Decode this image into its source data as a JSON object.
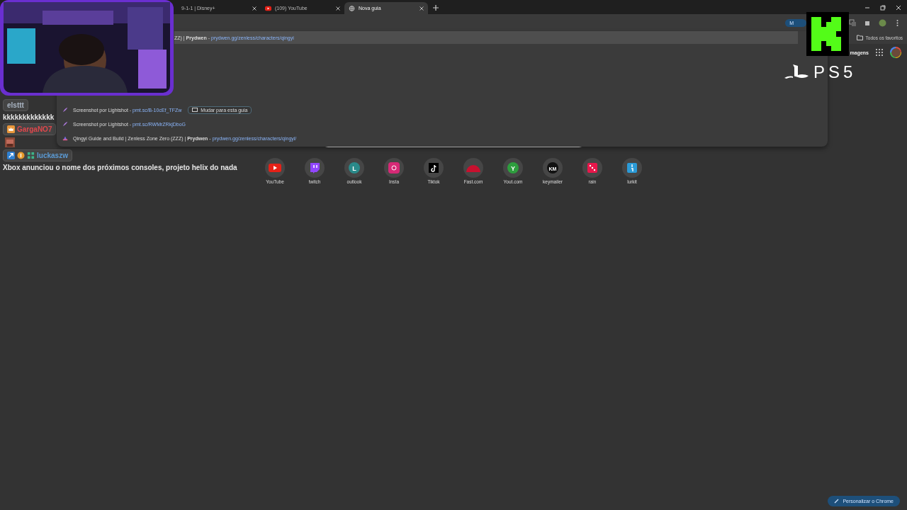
{
  "tabs": [
    {
      "title": "9-1-1 | Disney+",
      "kind": "plain",
      "selected": false
    },
    {
      "title": "(109) YouTube",
      "kind": "video",
      "selected": false
    },
    {
      "title": "Nova guia",
      "kind": "newtab",
      "selected": true
    }
  ],
  "toolbar": {
    "chip": "M"
  },
  "bookmarks_bar": {
    "folder": "Todos os favoritos"
  },
  "omnibox": {
    "text": "ZZ) | **Prydwen** - ",
    "url": "prydwen.gg/zenless/characters/qingyi",
    "suggestions": [
      {
        "kind": "feather",
        "title": "Screenshot por Lightshot - ",
        "url": "pmt.sc/B-10cEf_TFZw",
        "action": "Mudar para esta guia"
      },
      {
        "kind": "feather",
        "title": "Screenshot por Lightshot - ",
        "url": "pmt.sc/RWMrZRkjDboG"
      },
      {
        "kind": "site",
        "title": "Qingyi Guide and Build | Zenless Zone Zero (ZZZ) | **Prydwen** - ",
        "url": "prydwen.gg/zenless/characters/qingyi/"
      }
    ]
  },
  "header": {
    "link": "magens"
  },
  "shortcuts": [
    {
      "label": "YouTube",
      "kind": "youtube",
      "color": "#e62117"
    },
    {
      "label": "twitch",
      "kind": "twitch",
      "color": "#9146ff"
    },
    {
      "label": "outlook",
      "kind": "letter",
      "glyph": "L",
      "color": "#2a8a8a"
    },
    {
      "label": "Insta",
      "kind": "instagram",
      "color": "#d62976"
    },
    {
      "label": "Tiktok",
      "kind": "tiktok",
      "color": "#000000"
    },
    {
      "label": "Fast.com",
      "kind": "gauge",
      "color": "#c8102e"
    },
    {
      "label": "Yout.com",
      "kind": "letter",
      "glyph": "Y",
      "color": "#2e9e3e"
    },
    {
      "label": "keymailer",
      "kind": "letter",
      "glyph": "KM",
      "color": "#111111"
    },
    {
      "label": "rain",
      "kind": "dice",
      "color": "#e8174b"
    },
    {
      "label": "lurkit",
      "kind": "bars",
      "color": "#2b9bd8"
    }
  ],
  "customize_button": "Personalizar o Chrome",
  "chat": [
    {
      "user": "elsttt",
      "color": "#a9b4c2",
      "text": "kkkkkkkkkkkkk"
    },
    {
      "user": "GargaNO7",
      "color": "#e0474c",
      "badges": [
        {
          "kind": "crown"
        }
      ],
      "emote": true
    },
    {
      "user": "luckaszw",
      "color": "#5b9bd5",
      "badges": [
        {
          "kind": "arrow"
        },
        {
          "kind": "coin"
        },
        {
          "kind": "bars"
        }
      ],
      "text": "Xbox anunciou o nome dos próximos consoles, projeto helix do nada"
    }
  ],
  "overlay": {
    "logo_text": "PS5"
  }
}
